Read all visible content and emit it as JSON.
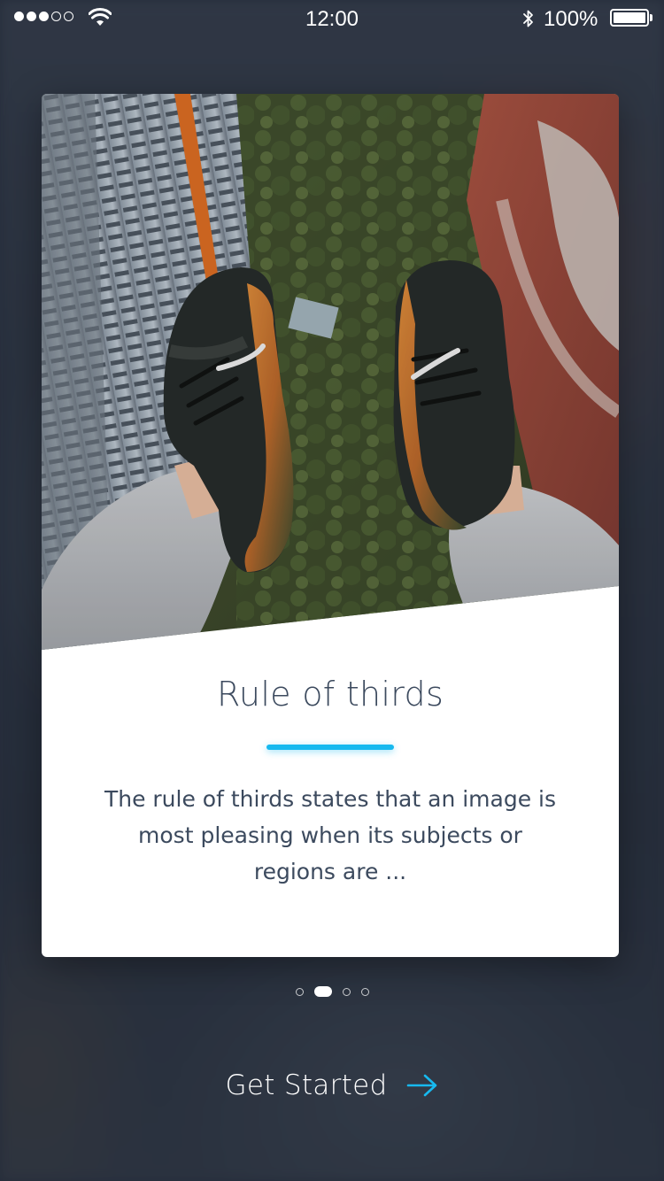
{
  "status_bar": {
    "signal_bars_filled": 3,
    "signal_bars_total": 5,
    "time": "12:00",
    "battery_percent": "100%",
    "icons": [
      "wifi-icon",
      "bluetooth-icon",
      "battery-icon"
    ]
  },
  "card": {
    "image": "photo-feet-above-city",
    "title": "Rule of thirds",
    "body": "The rule of thirds states that an image is most pleasing when its subjects or regions are ..."
  },
  "pager": {
    "total": 4,
    "active_index": 1
  },
  "cta": {
    "label": "Get Started",
    "icon": "arrow-right-icon"
  },
  "colors": {
    "accent": "#17b9ef",
    "text_dark": "#3c4a5e",
    "background": "#2f3644"
  }
}
